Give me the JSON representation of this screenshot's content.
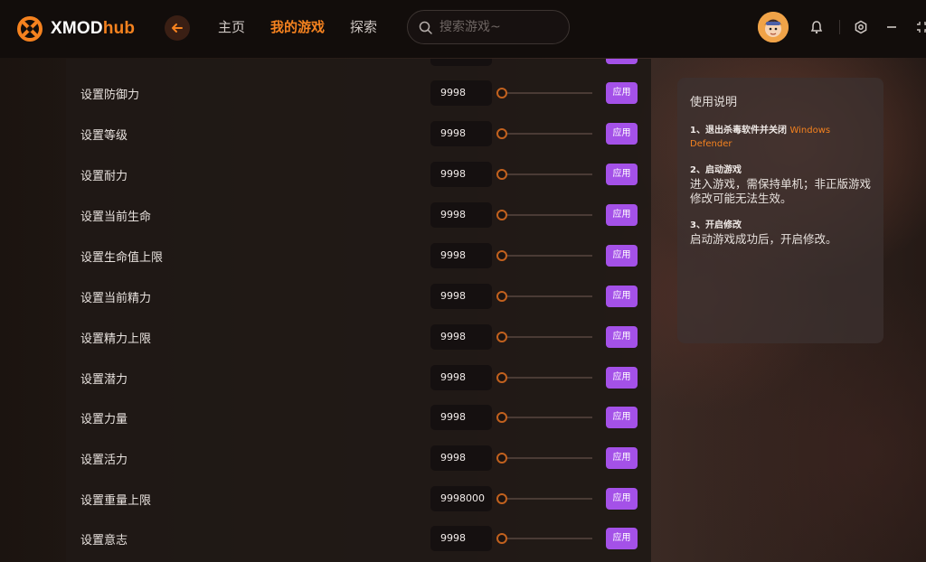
{
  "app": {
    "logo_main": "XMOD",
    "logo_accent": "hub"
  },
  "nav": {
    "items": [
      {
        "label": "主页",
        "active": false
      },
      {
        "label": "我的游戏",
        "active": true
      },
      {
        "label": "探索",
        "active": false
      }
    ]
  },
  "search": {
    "placeholder": "搜索游戏~"
  },
  "colors": {
    "accent": "#f5821f",
    "button": "#a451e8"
  },
  "settings": {
    "apply_label": "应用",
    "rows": [
      {
        "label": "设置防御力",
        "value": "9998"
      },
      {
        "label": "设置等级",
        "value": "9998"
      },
      {
        "label": "设置耐力",
        "value": "9998"
      },
      {
        "label": "设置当前生命",
        "value": "9998"
      },
      {
        "label": "设置生命值上限",
        "value": "9998"
      },
      {
        "label": "设置当前精力",
        "value": "9998"
      },
      {
        "label": "设置精力上限",
        "value": "9998"
      },
      {
        "label": "设置潜力",
        "value": "9998"
      },
      {
        "label": "设置力量",
        "value": "9998"
      },
      {
        "label": "设置活力",
        "value": "9998"
      },
      {
        "label": "设置重量上限",
        "value": "9998000"
      },
      {
        "label": "设置意志",
        "value": "9998"
      }
    ]
  },
  "instructions": {
    "title": "使用说明",
    "steps": [
      {
        "head": "1、退出杀毒软件并关闭",
        "highlight": "Windows Defender",
        "body": ""
      },
      {
        "head": "2、启动游戏",
        "highlight": "",
        "body": "进入游戏，需保持单机；非正版游戏修改可能无法生效。"
      },
      {
        "head": "3、开启修改",
        "highlight": "",
        "body": "启动游戏成功后，开启修改。"
      }
    ]
  }
}
